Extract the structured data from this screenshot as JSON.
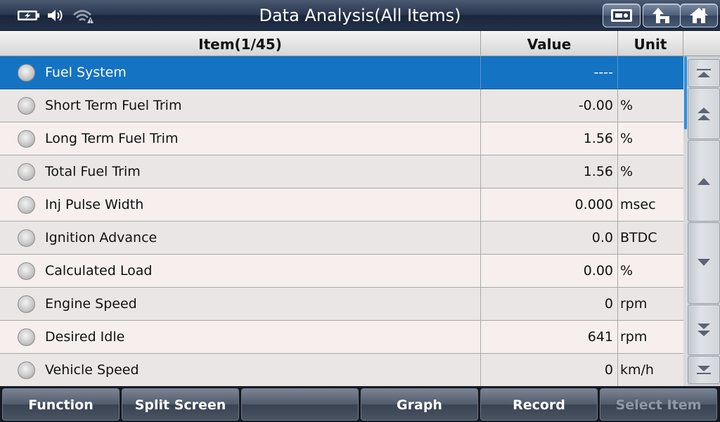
{
  "title": "Data Analysis(All Items)",
  "status": {
    "battery_icon": "battery-charging-icon",
    "volume_icon": "speaker-icon",
    "wifi_icon": "wifi-warning-icon"
  },
  "toolbar": {
    "buttons": [
      {
        "icon": "screenshot-icon"
      },
      {
        "icon": "back-up-arrow-icon"
      },
      {
        "icon": "home-icon"
      }
    ]
  },
  "table": {
    "columns": {
      "item": "Item(1/45)",
      "value": "Value",
      "unit": "Unit"
    },
    "rows": [
      {
        "item": "Fuel System",
        "value": "----",
        "unit": "",
        "selected": true
      },
      {
        "item": "Short Term Fuel Trim",
        "value": "-0.00",
        "unit": "%"
      },
      {
        "item": "Long Term Fuel Trim",
        "value": "1.56",
        "unit": "%"
      },
      {
        "item": "Total Fuel Trim",
        "value": "1.56",
        "unit": "%"
      },
      {
        "item": "Inj Pulse Width",
        "value": "0.000",
        "unit": "msec"
      },
      {
        "item": "Ignition Advance",
        "value": "0.0",
        "unit": "BTDC"
      },
      {
        "item": "Calculated Load",
        "value": "0.00",
        "unit": "%"
      },
      {
        "item": "Engine Speed",
        "value": "0",
        "unit": "rpm"
      },
      {
        "item": "Desired Idle",
        "value": "641",
        "unit": "rpm"
      },
      {
        "item": "Vehicle Speed",
        "value": "0",
        "unit": "km/h"
      }
    ]
  },
  "scroll_buttons": [
    "scroll-top-icon",
    "page-up-icon",
    "line-up-icon",
    "line-down-icon",
    "page-down-icon",
    "scroll-bottom-icon"
  ],
  "bottom": {
    "buttons": [
      {
        "label": "Function",
        "enabled": true
      },
      {
        "label": "Split Screen",
        "enabled": true
      },
      {
        "label": "",
        "enabled": true
      },
      {
        "label": "Graph",
        "enabled": true
      },
      {
        "label": "Record",
        "enabled": true
      },
      {
        "label": "Select Item",
        "enabled": false
      }
    ]
  },
  "colors": {
    "selected_row": "#1473c2",
    "titlebar": "#2a3750",
    "scroll_thumb": "#2d8fe0"
  }
}
